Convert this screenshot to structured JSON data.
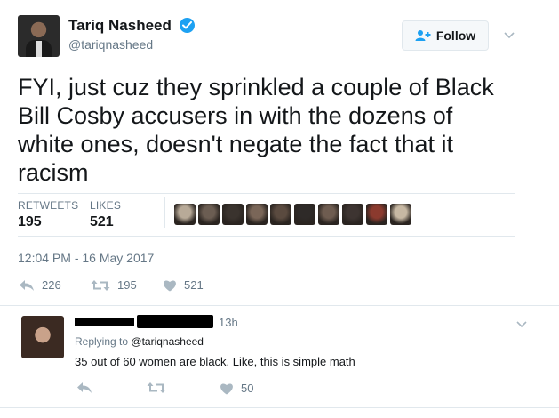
{
  "tweet": {
    "author_name": "Tariq Nasheed",
    "author_handle": "@tariqnasheed",
    "follow_label": "Follow",
    "text": "FYI, just cuz they sprinkled a couple of Black\nBill Cosby accusers in with the dozens of\nwhite ones, doesn't negate the fact that it\nracism",
    "retweets_label": "RETWEETS",
    "retweets_count": "195",
    "likes_label": "LIKES",
    "likes_count": "521",
    "timestamp": "12:04 PM - 16 May 2017",
    "actions": {
      "reply_count": "226",
      "retweet_count": "195",
      "like_count": "521"
    },
    "liker_avatar_colors": [
      "#b8aa98",
      "#6b5d52",
      "#3a332e",
      "#7a6658",
      "#5a4a3f",
      "#2e2a28",
      "#6e5c50",
      "#3d3431",
      "#8b3a2e",
      "#c7b8a3"
    ]
  },
  "reply": {
    "time": "13h",
    "replying_prefix": "Replying to",
    "replying_handle": "@tariqnasheed",
    "text": "35 out of 60 women are black. Like, this is simple math",
    "actions": {
      "like_count": "50"
    }
  },
  "colors": {
    "accent": "#1da1f2",
    "muted": "#657786",
    "text": "#14171a",
    "border": "#e1e8ed"
  },
  "icons": [
    "verified-badge-icon",
    "follow-person-icon",
    "chevron-down-icon",
    "reply-icon",
    "retweet-icon",
    "heart-icon"
  ]
}
